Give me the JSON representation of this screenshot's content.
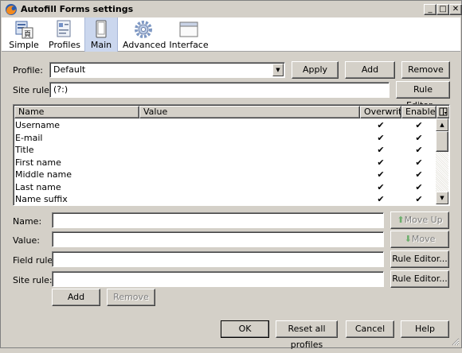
{
  "window": {
    "title": "Autofill Forms settings",
    "min_glyph": "_",
    "max_glyph": "□",
    "close_glyph": "✕"
  },
  "toolbar": {
    "items": [
      {
        "label": "Simple",
        "icon": "simple-icon"
      },
      {
        "label": "Profiles",
        "icon": "profiles-icon"
      },
      {
        "label": "Main",
        "icon": "main-icon",
        "selected": true
      },
      {
        "label": "Advanced",
        "icon": "gear-icon"
      },
      {
        "label": "Interface",
        "icon": "window-icon"
      }
    ]
  },
  "profile": {
    "label": "Profile:",
    "value": "Default",
    "apply_label": "Apply",
    "add_label": "Add",
    "remove_label": "Remove"
  },
  "site_rule_top": {
    "label": "Site rule:",
    "value": "(?:)",
    "editor_label": "Rule Editor..."
  },
  "fields_list": {
    "columns": {
      "name": "Name",
      "value": "Value",
      "overwrite": "Overwrite",
      "enabled": "Enabled"
    },
    "rows": [
      {
        "name": "Username",
        "value": "",
        "overwrite": "✔",
        "enabled": "✔"
      },
      {
        "name": "E-mail",
        "value": "",
        "overwrite": "✔",
        "enabled": "✔"
      },
      {
        "name": "Title",
        "value": "",
        "overwrite": "✔",
        "enabled": "✔"
      },
      {
        "name": "First name",
        "value": "",
        "overwrite": "✔",
        "enabled": "✔"
      },
      {
        "name": "Middle name",
        "value": "",
        "overwrite": "✔",
        "enabled": "✔"
      },
      {
        "name": "Last name",
        "value": "",
        "overwrite": "✔",
        "enabled": "✔"
      },
      {
        "name": "Name suffix",
        "value": "",
        "overwrite": "✔",
        "enabled": "✔"
      }
    ]
  },
  "edit": {
    "name_label": "Name:",
    "name_value": "",
    "value_label": "Value:",
    "value_value": "",
    "field_rule_label": "Field rule:",
    "field_rule_value": "",
    "site_rule_label": "Site rule:",
    "site_rule_value": "",
    "move_up_label": "Move Up",
    "move_down_label": "Move Down",
    "field_rule_editor_label": "Rule Editor...",
    "site_rule_editor_label": "Rule Editor...",
    "add_label": "Add",
    "remove_label": "Remove"
  },
  "footer": {
    "ok_label": "OK",
    "reset_label": "Reset all profiles",
    "cancel_label": "Cancel",
    "help_label": "Help"
  }
}
